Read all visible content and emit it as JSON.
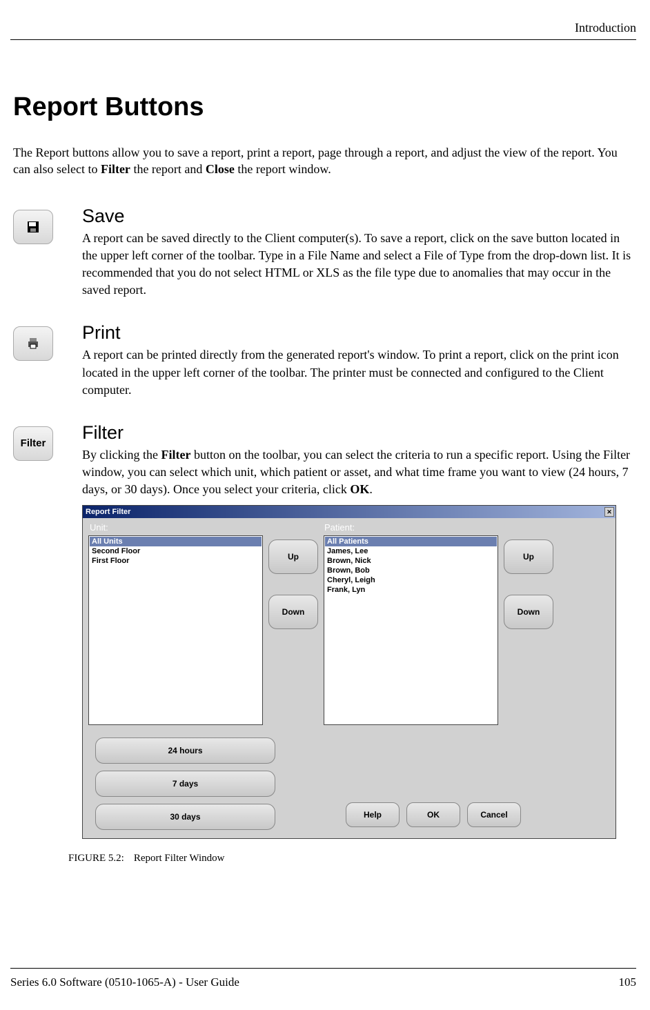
{
  "header": {
    "breadcrumb": "Introduction"
  },
  "page": {
    "title": "Report Buttons",
    "intro_pre": "The Report buttons allow you to save a report, print a report, page through a report, and adjust the view of the report. You can also select to ",
    "intro_bold1": "Filter",
    "intro_mid": " the report and ",
    "intro_bold2": "Close",
    "intro_post": " the report window."
  },
  "sections": {
    "save": {
      "heading": "Save",
      "body": "A report can be saved directly to the Client computer(s). To save a report, click on the save button located in the upper left corner of the toolbar. Type in a File Name and select a File of Type from the drop-down list. It is recommended that you do not select HTML or XLS as the file type due to anomalies that may occur in the saved report."
    },
    "print": {
      "heading": "Print",
      "body": "A report can be printed directly from the generated report's window. To print a report, click on the print icon located in the upper left corner of the toolbar. The printer must be connected and configured to the Client computer."
    },
    "filter": {
      "heading": "Filter",
      "icon_label": "Filter",
      "body_pre": "By clicking the ",
      "body_b1": "Filter",
      "body_mid": " button on the toolbar, you can select the criteria to run a specific report. Using the Filter window, you can select which unit, which patient or asset, and what time frame you want to view (24 hours, 7 days, or 30 days). Once you select your criteria, click ",
      "body_b2": "OK",
      "body_post": "."
    }
  },
  "dialog": {
    "title": "Report Filter",
    "unit_label": "Unit:",
    "patient_label": "Patient:",
    "units": [
      "All Units",
      "Second Floor",
      "First Floor"
    ],
    "patients": [
      "All Patients",
      "James, Lee",
      "Brown, Nick",
      "Brown, Bob",
      "Cheryl, Leigh",
      "Frank, Lyn"
    ],
    "up": "Up",
    "down": "Down",
    "time": {
      "t24": "24 hours",
      "t7": "7 days",
      "t30": "30 days"
    },
    "actions": {
      "help": "Help",
      "ok": "OK",
      "cancel": "Cancel"
    }
  },
  "figure": {
    "num": "FIGURE 5.2:",
    "caption": "Report Filter Window"
  },
  "footer": {
    "left": "Series 6.0 Software (0510-1065-A) - User Guide",
    "right": "105"
  }
}
